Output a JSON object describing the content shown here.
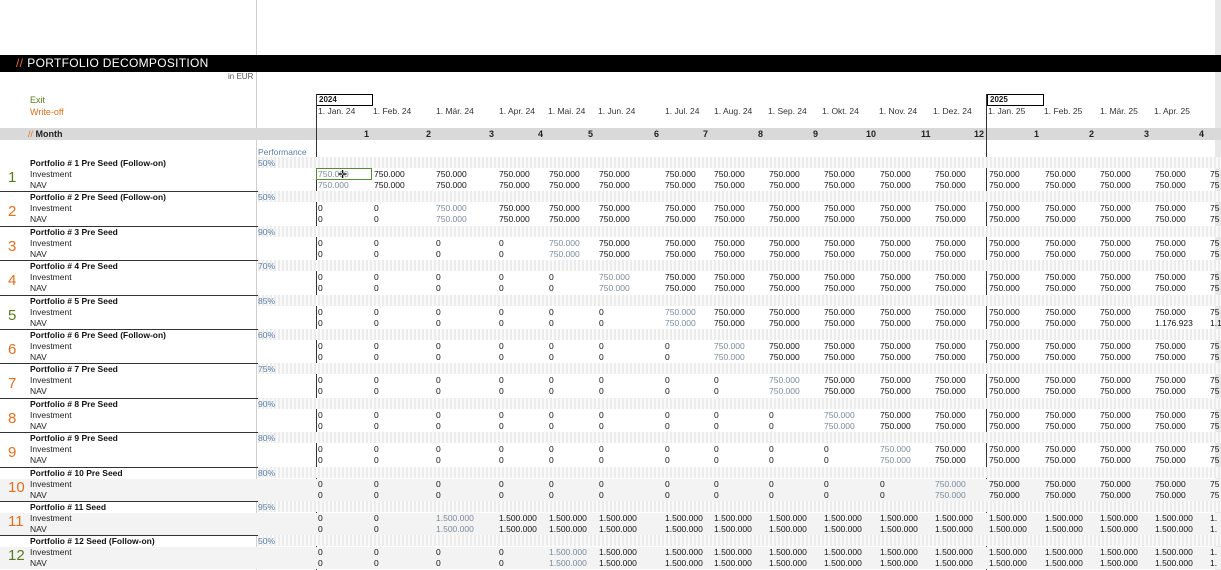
{
  "sheet": {
    "title_prefix": "//",
    "title": "PORTFOLIO DECOMPOSITION",
    "units": "in EUR",
    "exit_label": "Exit",
    "writeoff_label": "Write-off",
    "month_prefix": "//",
    "month_label": "Month",
    "performance_label": "Performance",
    "years": [
      "2024",
      "2025"
    ],
    "dates": [
      "1. Jan. 24",
      "1. Feb. 24",
      "1. Mär. 24",
      "1. Apr. 24",
      "1. Mai. 24",
      "1. Jun. 24",
      "1. Jul. 24",
      "1. Aug. 24",
      "1. Sep. 24",
      "1. Okt. 24",
      "1. Nov. 24",
      "1. Dez. 24",
      "1. Jan. 25",
      "1. Feb. 25",
      "1. Mär. 25",
      "1. Apr. 25"
    ],
    "months": [
      "1",
      "2",
      "3",
      "4",
      "5",
      "6",
      "7",
      "8",
      "9",
      "10",
      "11",
      "12",
      "1",
      "2",
      "3",
      "4"
    ],
    "row_labels": {
      "investment": "Investment",
      "nav": "NAV"
    }
  },
  "portfolios": [
    {
      "num": "1",
      "name": "Portfolio # 1 Pre Seed (Follow-on)",
      "perf": "50%",
      "num_color": "#5a7a1e",
      "investment": [
        "750.000",
        "750.000",
        "750.000",
        "750.000",
        "750.000",
        "750.000",
        "750.000",
        "750.000",
        "750.000",
        "750.000",
        "750.000",
        "750.000",
        "750.000",
        "750.000",
        "750.000",
        "750.000",
        "75"
      ],
      "nav": [
        "750.000",
        "750.000",
        "750.000",
        "750.000",
        "750.000",
        "750.000",
        "750.000",
        "750.000",
        "750.000",
        "750.000",
        "750.000",
        "750.000",
        "750.000",
        "750.000",
        "750.000",
        "750.000",
        "75"
      ],
      "first": 0
    },
    {
      "num": "2",
      "name": "Portfolio # 2 Pre Seed (Follow-on)",
      "perf": "50%",
      "num_color": "#e07020",
      "investment": [
        "0",
        "0",
        "750.000",
        "750.000",
        "750.000",
        "750.000",
        "750.000",
        "750.000",
        "750.000",
        "750.000",
        "750.000",
        "750.000",
        "750.000",
        "750.000",
        "750.000",
        "750.000",
        "75"
      ],
      "nav": [
        "0",
        "0",
        "750.000",
        "750.000",
        "750.000",
        "750.000",
        "750.000",
        "750.000",
        "750.000",
        "750.000",
        "750.000",
        "750.000",
        "750.000",
        "750.000",
        "750.000",
        "750.000",
        "75"
      ],
      "first": 2
    },
    {
      "num": "3",
      "name": "Portfolio # 3 Pre Seed",
      "perf": "90%",
      "num_color": "#e07020",
      "investment": [
        "0",
        "0",
        "0",
        "0",
        "750.000",
        "750.000",
        "750.000",
        "750.000",
        "750.000",
        "750.000",
        "750.000",
        "750.000",
        "750.000",
        "750.000",
        "750.000",
        "750.000",
        "75"
      ],
      "nav": [
        "0",
        "0",
        "0",
        "0",
        "750.000",
        "750.000",
        "750.000",
        "750.000",
        "750.000",
        "750.000",
        "750.000",
        "750.000",
        "750.000",
        "750.000",
        "750.000",
        "750.000",
        "75"
      ],
      "first": 4
    },
    {
      "num": "4",
      "name": "Portfolio # 4 Pre Seed",
      "perf": "70%",
      "num_color": "#e07020",
      "investment": [
        "0",
        "0",
        "0",
        "0",
        "0",
        "750.000",
        "750.000",
        "750.000",
        "750.000",
        "750.000",
        "750.000",
        "750.000",
        "750.000",
        "750.000",
        "750.000",
        "750.000",
        "75"
      ],
      "nav": [
        "0",
        "0",
        "0",
        "0",
        "0",
        "750.000",
        "750.000",
        "750.000",
        "750.000",
        "750.000",
        "750.000",
        "750.000",
        "750.000",
        "750.000",
        "750.000",
        "750.000",
        "75"
      ],
      "first": 5
    },
    {
      "num": "5",
      "name": "Portfolio # 5 Pre Seed",
      "perf": "85%",
      "num_color": "#5a7a1e",
      "investment": [
        "0",
        "0",
        "0",
        "0",
        "0",
        "0",
        "750.000",
        "750.000",
        "750.000",
        "750.000",
        "750.000",
        "750.000",
        "750.000",
        "750.000",
        "750.000",
        "750.000",
        "75"
      ],
      "nav": [
        "0",
        "0",
        "0",
        "0",
        "0",
        "0",
        "750.000",
        "750.000",
        "750.000",
        "750.000",
        "750.000",
        "750.000",
        "750.000",
        "750.000",
        "750.000",
        "1.176.923",
        "1.1"
      ],
      "first": 6
    },
    {
      "num": "6",
      "name": "Portfolio # 6 Pre Seed (Follow-on)",
      "perf": "60%",
      "num_color": "#e07020",
      "investment": [
        "0",
        "0",
        "0",
        "0",
        "0",
        "0",
        "0",
        "750.000",
        "750.000",
        "750.000",
        "750.000",
        "750.000",
        "750.000",
        "750.000",
        "750.000",
        "750.000",
        "75"
      ],
      "nav": [
        "0",
        "0",
        "0",
        "0",
        "0",
        "0",
        "0",
        "750.000",
        "750.000",
        "750.000",
        "750.000",
        "750.000",
        "750.000",
        "750.000",
        "750.000",
        "750.000",
        "75"
      ],
      "first": 7
    },
    {
      "num": "7",
      "name": "Portfolio # 7 Pre Seed",
      "perf": "75%",
      "num_color": "#e07020",
      "investment": [
        "0",
        "0",
        "0",
        "0",
        "0",
        "0",
        "0",
        "0",
        "750.000",
        "750.000",
        "750.000",
        "750.000",
        "750.000",
        "750.000",
        "750.000",
        "750.000",
        "75"
      ],
      "nav": [
        "0",
        "0",
        "0",
        "0",
        "0",
        "0",
        "0",
        "0",
        "750.000",
        "750.000",
        "750.000",
        "750.000",
        "750.000",
        "750.000",
        "750.000",
        "750.000",
        "75"
      ],
      "first": 8
    },
    {
      "num": "8",
      "name": "Portfolio # 8 Pre Seed",
      "perf": "90%",
      "num_color": "#e07020",
      "investment": [
        "0",
        "0",
        "0",
        "0",
        "0",
        "0",
        "0",
        "0",
        "0",
        "750.000",
        "750.000",
        "750.000",
        "750.000",
        "750.000",
        "750.000",
        "750.000",
        "75"
      ],
      "nav": [
        "0",
        "0",
        "0",
        "0",
        "0",
        "0",
        "0",
        "0",
        "0",
        "750.000",
        "750.000",
        "750.000",
        "750.000",
        "750.000",
        "750.000",
        "750.000",
        "75"
      ],
      "first": 9
    },
    {
      "num": "9",
      "name": "Portfolio # 9 Pre Seed",
      "perf": "80%",
      "num_color": "#e07020",
      "investment": [
        "0",
        "0",
        "0",
        "0",
        "0",
        "0",
        "0",
        "0",
        "0",
        "0",
        "750.000",
        "750.000",
        "750.000",
        "750.000",
        "750.000",
        "750.000",
        "75"
      ],
      "nav": [
        "0",
        "0",
        "0",
        "0",
        "0",
        "0",
        "0",
        "0",
        "0",
        "0",
        "750.000",
        "750.000",
        "750.000",
        "750.000",
        "750.000",
        "750.000",
        "75"
      ],
      "first": 10
    },
    {
      "num": "10",
      "name": "Portfolio # 10 Pre Seed",
      "perf": "80%",
      "num_color": "#e07020",
      "investment": [
        "0",
        "0",
        "0",
        "0",
        "0",
        "0",
        "0",
        "0",
        "0",
        "0",
        "0",
        "750.000",
        "750.000",
        "750.000",
        "750.000",
        "750.000",
        "75"
      ],
      "nav": [
        "0",
        "0",
        "0",
        "0",
        "0",
        "0",
        "0",
        "0",
        "0",
        "0",
        "0",
        "750.000",
        "750.000",
        "750.000",
        "750.000",
        "750.000",
        "75"
      ],
      "first": 11
    },
    {
      "num": "11",
      "name": "Portfolio # 11 Seed",
      "perf": "95%",
      "num_color": "#e07020",
      "investment": [
        "0",
        "0",
        "1.500.000",
        "1.500.000",
        "1.500.000",
        "1.500.000",
        "1.500.000",
        "1.500.000",
        "1.500.000",
        "1.500.000",
        "1.500.000",
        "1.500.000",
        "1.500.000",
        "1.500.000",
        "1.500.000",
        "1.500.000",
        "1."
      ],
      "nav": [
        "0",
        "0",
        "1.500.000",
        "1.500.000",
        "1.500.000",
        "1.500.000",
        "1.500.000",
        "1.500.000",
        "1.500.000",
        "1.500.000",
        "1.500.000",
        "1.500.000",
        "1.500.000",
        "1.500.000",
        "1.500.000",
        "1.500.000",
        "1."
      ],
      "first": 2
    },
    {
      "num": "12",
      "name": "Portfolio # 12 Seed (Follow-on)",
      "perf": "50%",
      "num_color": "#5a7a1e",
      "investment": [
        "0",
        "0",
        "0",
        "0",
        "1.500.000",
        "1.500.000",
        "1.500.000",
        "1.500.000",
        "1.500.000",
        "1.500.000",
        "1.500.000",
        "1.500.000",
        "1.500.000",
        "1.500.000",
        "1.500.000",
        "1.500.000",
        "1."
      ],
      "nav": [
        "0",
        "0",
        "0",
        "0",
        "1.500.000",
        "1.500.000",
        "1.500.000",
        "1.500.000",
        "1.500.000",
        "1.500.000",
        "1.500.000",
        "1.500.000",
        "1.500.000",
        "1.500.000",
        "1.500.000",
        "1.500.000",
        "1."
      ],
      "first": 4
    }
  ]
}
